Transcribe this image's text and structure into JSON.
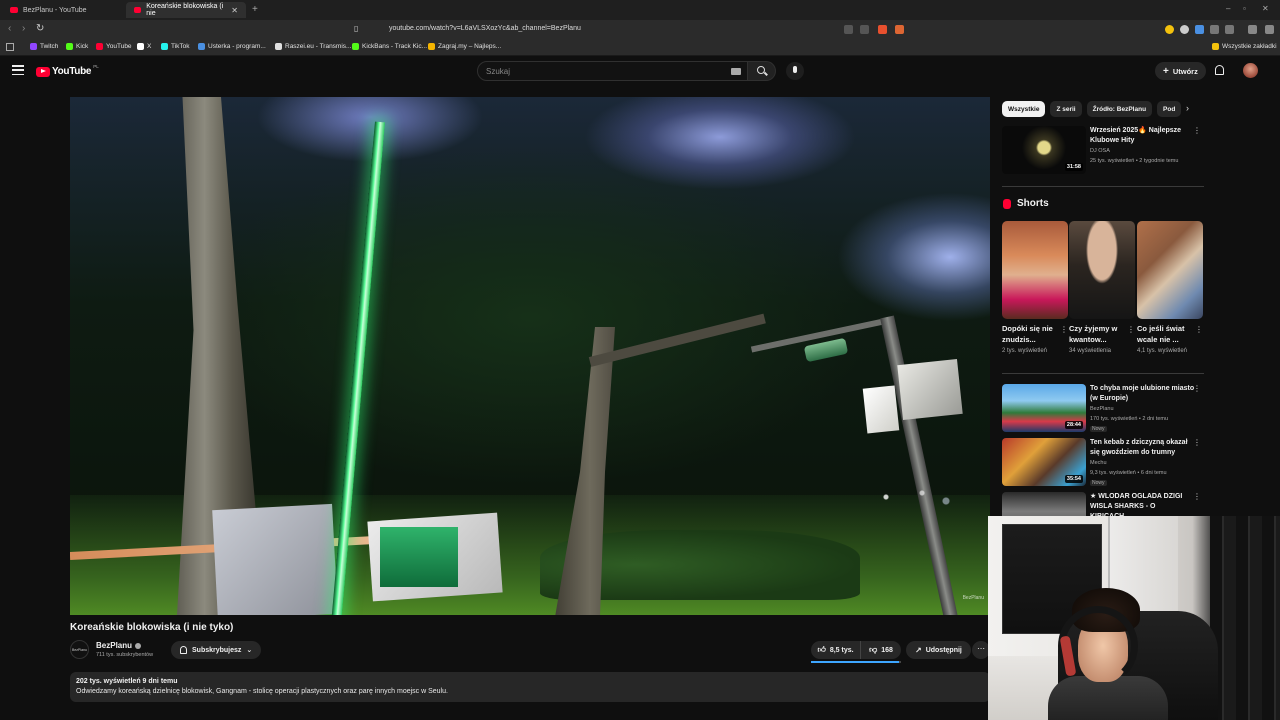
{
  "browser": {
    "tabs": [
      {
        "title": "BezPlanu - YouTube",
        "active": false
      },
      {
        "title": "Koreańskie blokowiska (i nie",
        "active": true
      }
    ],
    "url": "youtube.com/watch?v=L6aVLSXozYc&ab_channel=BezPlanu",
    "bookmarks": [
      {
        "label": "Twitch",
        "icon_color": "#9146ff"
      },
      {
        "label": "Kick",
        "icon_color": "#53fc18"
      },
      {
        "label": "YouTube",
        "icon_color": "#ff0033"
      },
      {
        "label": "X",
        "icon_color": "#ffffff"
      },
      {
        "label": "TikTok",
        "icon_color": "#25f4ee"
      },
      {
        "label": "Usterka - program...",
        "icon_color": "#4a90e2"
      },
      {
        "label": "Raszei.eu - Transmis...",
        "icon_color": "#e0e0e0"
      },
      {
        "label": "KickBans - Track Kic...",
        "icon_color": "#53fc18"
      },
      {
        "label": "Zagraj.my – Najleps...",
        "icon_color": "#f4b400"
      }
    ],
    "all_bookmarks_label": "Wszystkie zakładki"
  },
  "youtube": {
    "logo_word": "YouTube",
    "logo_region": "PL",
    "search_placeholder": "Szukaj",
    "create_label": "Utwórz",
    "brand_color": "#ff0033"
  },
  "video": {
    "title": "Koreańskie blokowiska (i nie tyko)",
    "watermark": "BezPlanu",
    "channel": {
      "name": "BezPlanu",
      "avatar_text": "BezPlanu",
      "subscribers": "711 tys. subskrybentów"
    },
    "subscribe_label": "Subskrybujesz",
    "likes": "8,5 tys.",
    "dislikes": "168",
    "like_ratio": 0.9806,
    "share_label": "Udostępnij",
    "more_label": "⋯",
    "description": {
      "meta": "202 tys. wyświetleń  9 dni temu",
      "text": "Odwiedzamy koreańską dzielnicę blokowisk, Gangnam - stolicę operacji plastycznych oraz parę innych moejsc w Seulu."
    }
  },
  "sidebar": {
    "chips": [
      "Wszystkie",
      "Z serii",
      "Źródło: BezPlanu",
      "Pod"
    ],
    "top_recommendation": {
      "title": "Wrzesień 2025🔥 Najlepsze Klubowe Hity",
      "channel": "DJ OSA",
      "meta": "25 tys. wyświetleń • 2 tygodnie temu",
      "duration": "31:58"
    },
    "shorts_label": "Shorts",
    "shorts": [
      {
        "title": "Dopóki się nie znudzis...",
        "views": "2 tys. wyświetleń"
      },
      {
        "title": "Czy żyjemy w kwantow...",
        "views": "34 wyświetlenia"
      },
      {
        "title": "Co jeśli świat wcale nie ...",
        "views": "4,1 tys. wyświetleń"
      }
    ],
    "recommendations": [
      {
        "title": "To chyba moje ulubione miasto (w Europie)",
        "channel": "BezPlanu",
        "meta": "170 tys. wyświetleń • 2 dni temu",
        "badge": "Nowy",
        "duration": "28:44"
      },
      {
        "title": "Ten kebab z dziczyzną okazał się gwoździem do trumny",
        "channel": "Mechu",
        "meta": "9,3 tys. wyświetleń • 6 dni temu",
        "badge": "Nowy",
        "duration": "35:54"
      },
      {
        "title": "★ WLODAR OGLADA DZIGI WISLA SHARKS - O KIBICACH,...",
        "channel": "",
        "meta": "",
        "badge": "",
        "duration": ""
      }
    ]
  }
}
